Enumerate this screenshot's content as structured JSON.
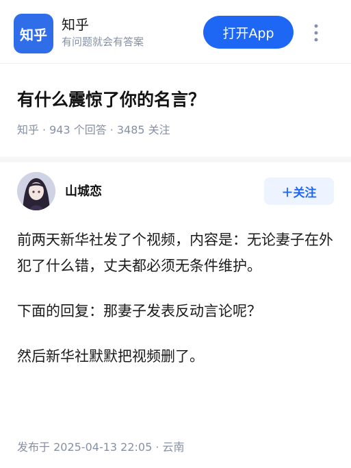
{
  "app_banner": {
    "logo_text": "知乎",
    "app_name": "知乎",
    "slogan": "有问题就会有答案",
    "open_button": "打开App",
    "more_icon": "more-vertical-icon",
    "brand_color": "#1e67f5"
  },
  "question": {
    "title": "有什么震惊了你的名言？",
    "meta": {
      "source": "知乎",
      "answers": "943 个回答",
      "followers": "3485 关注"
    }
  },
  "answer": {
    "author": "山城恋",
    "follow_button": "＋关注",
    "paragraphs": [
      "前两天新华社发了个视频，内容是：无论妻子在外犯了什么错，丈夫都必须无条件维护。",
      "下面的回复：那妻子发表反动言论呢？",
      "然后新华社默默把视频删了。"
    ],
    "publish_info": "发布于 2025-04-13 22:05 · 云南"
  }
}
